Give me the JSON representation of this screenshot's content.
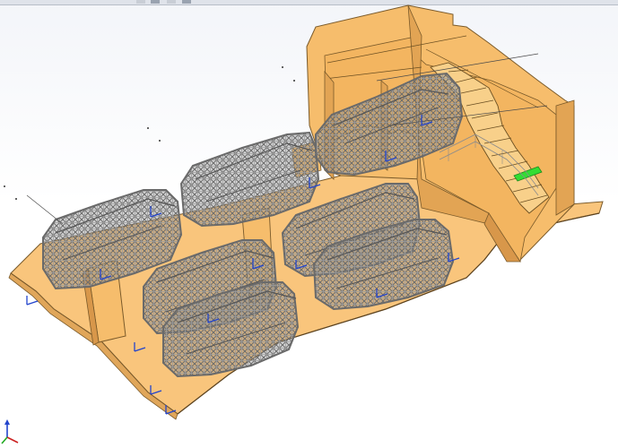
{
  "app": {
    "viewport": "cad-3d-viewport",
    "colors": {
      "background": "#ffffff",
      "floor": "#f9c57c",
      "floor_edge": "#7a5a2a",
      "wall": "#f6bd6c",
      "wall_dark": "#e2a454",
      "wall_inner": "#f3b560",
      "stair_tread": "#f8d08a",
      "vehicle_wire": "#7d7d7d",
      "vehicle_dark": "#555555",
      "triad_blue": "#2244cc",
      "highlight_step": "#33dd33"
    },
    "icons": {
      "origin_triad": "axis-triad-icon",
      "coordinate_system": "coordinate-system-icon",
      "sketch_point": "sketch-point-icon"
    },
    "vehicle_count": 7
  }
}
